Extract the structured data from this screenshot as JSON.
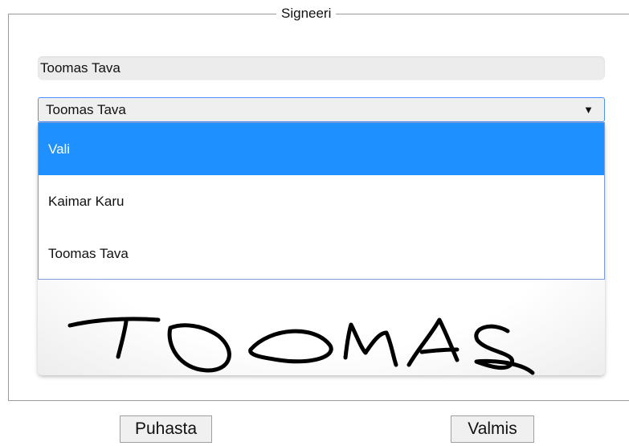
{
  "signer": {
    "legend": "Signeeri",
    "name_value": "Toomas Tava",
    "select": {
      "selected_label": "Toomas Tava",
      "arrow": "▼",
      "options": [
        {
          "label": "Vali",
          "highlighted": true
        },
        {
          "label": "Kaimar Karu",
          "highlighted": false
        },
        {
          "label": "Toomas Tava",
          "highlighted": false
        }
      ]
    }
  },
  "signature": {
    "drawn": "TOOMAS"
  },
  "buttons": {
    "clear_label": "Puhasta",
    "done_label": "Valmis"
  },
  "colors": {
    "highlight": "#1e90ff",
    "select_border": "#4d90fe",
    "frame_border": "#9a9a9a"
  }
}
